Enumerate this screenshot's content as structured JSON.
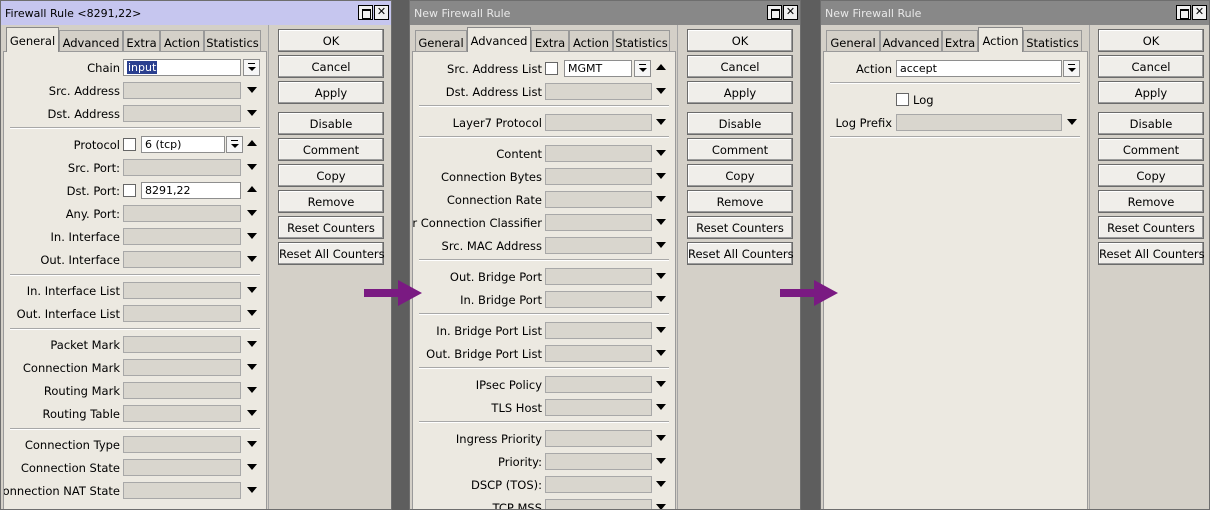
{
  "window1": {
    "title": "Firewall Rule <8291,22>",
    "tabs": [
      "General",
      "Advanced",
      "Extra",
      "Action",
      "Statistics"
    ],
    "selected_tab": "General",
    "fields": {
      "chain": {
        "label": "Chain",
        "value": "input"
      },
      "src_address": {
        "label": "Src. Address"
      },
      "dst_address": {
        "label": "Dst. Address"
      },
      "protocol": {
        "label": "Protocol",
        "value": "6 (tcp)"
      },
      "src_port": {
        "label": "Src. Port:"
      },
      "dst_port": {
        "label": "Dst. Port:",
        "value": "8291,22"
      },
      "any_port": {
        "label": "Any. Port:"
      },
      "in_interface": {
        "label": "In. Interface"
      },
      "out_interface": {
        "label": "Out. Interface"
      },
      "in_interface_list": {
        "label": "In. Interface List"
      },
      "out_interface_list": {
        "label": "Out. Interface List"
      },
      "packet_mark": {
        "label": "Packet Mark"
      },
      "connection_mark": {
        "label": "Connection Mark"
      },
      "routing_mark": {
        "label": "Routing Mark"
      },
      "routing_table": {
        "label": "Routing Table"
      },
      "connection_type": {
        "label": "Connection Type"
      },
      "connection_state": {
        "label": "Connection State"
      },
      "connection_nat_state": {
        "label": "Connection NAT State"
      }
    }
  },
  "window2": {
    "title": "New Firewall Rule",
    "tabs": [
      "General",
      "Advanced",
      "Extra",
      "Action",
      "Statistics"
    ],
    "selected_tab": "Advanced",
    "fields": {
      "src_address_list": {
        "label": "Src. Address List",
        "value": "MGMT"
      },
      "dst_address_list": {
        "label": "Dst. Address List"
      },
      "layer7_protocol": {
        "label": "Layer7 Protocol"
      },
      "content": {
        "label": "Content"
      },
      "connection_bytes": {
        "label": "Connection Bytes"
      },
      "connection_rate": {
        "label": "Connection Rate"
      },
      "per_connection_classifier": {
        "label": "Per Connection Classifier"
      },
      "src_mac_address": {
        "label": "Src. MAC Address"
      },
      "out_bridge_port": {
        "label": "Out. Bridge Port"
      },
      "in_bridge_port": {
        "label": "In. Bridge Port"
      },
      "in_bridge_port_list": {
        "label": "In. Bridge Port List"
      },
      "out_bridge_port_list": {
        "label": "Out. Bridge Port List"
      },
      "ipsec_policy": {
        "label": "IPsec Policy"
      },
      "tls_host": {
        "label": "TLS Host"
      },
      "ingress_priority": {
        "label": "Ingress Priority"
      },
      "priority": {
        "label": "Priority:"
      },
      "dscp": {
        "label": "DSCP (TOS):"
      },
      "tcp_mss": {
        "label": "TCP MSS"
      }
    }
  },
  "window3": {
    "title": "New Firewall Rule",
    "tabs": [
      "General",
      "Advanced",
      "Extra",
      "Action",
      "Statistics"
    ],
    "selected_tab": "Action",
    "fields": {
      "action": {
        "label": "Action",
        "value": "accept"
      },
      "log": {
        "label": "Log"
      },
      "log_prefix": {
        "label": "Log Prefix"
      }
    }
  },
  "buttons": [
    "OK",
    "Cancel",
    "Apply",
    "Disable",
    "Comment",
    "Copy",
    "Remove",
    "Reset Counters",
    "Reset All Counters"
  ],
  "colors": {
    "active_title": "#c6c6ef",
    "inactive_title": "#888888",
    "arrow": "#7a1a82",
    "selection": "#2a3f8f"
  }
}
